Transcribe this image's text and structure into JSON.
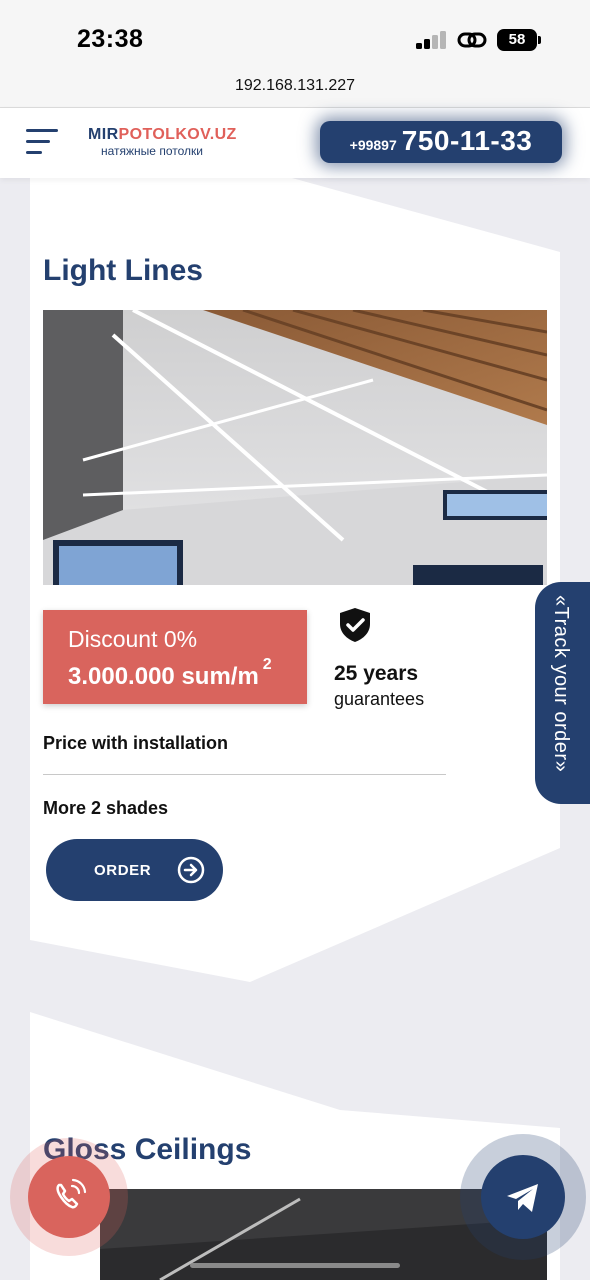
{
  "status_bar": {
    "time": "23:38",
    "battery": "58"
  },
  "browser": {
    "url": "192.168.131.227"
  },
  "header": {
    "logo_part1": "MIR",
    "logo_part2": "POTOLKOV.UZ",
    "logo_tagline": "натяжные потолки",
    "phone_prefix": "+99897",
    "phone_number": "750-11-33"
  },
  "product": {
    "title": "Light Lines",
    "discount": "Discount 0%",
    "price": "3.000.000 sum/m",
    "price_unit_power": "2",
    "guarantee_years": "25 years",
    "guarantee_label": "guarantees",
    "price_note": "Price with installation",
    "shades": "More 2 shades",
    "order_label": "ORDER"
  },
  "next_product": {
    "title": "Gloss Ceilings"
  },
  "track_order": {
    "label": "«Track your order»"
  },
  "colors": {
    "primary": "#24406f",
    "accent": "#d9645d",
    "background": "#ececf1"
  },
  "icons": [
    "hamburger-menu-icon",
    "shield-check-icon",
    "arrow-right-circle-icon",
    "phone-call-icon",
    "telegram-send-icon",
    "signal-icon",
    "link-icon",
    "battery-icon"
  ]
}
